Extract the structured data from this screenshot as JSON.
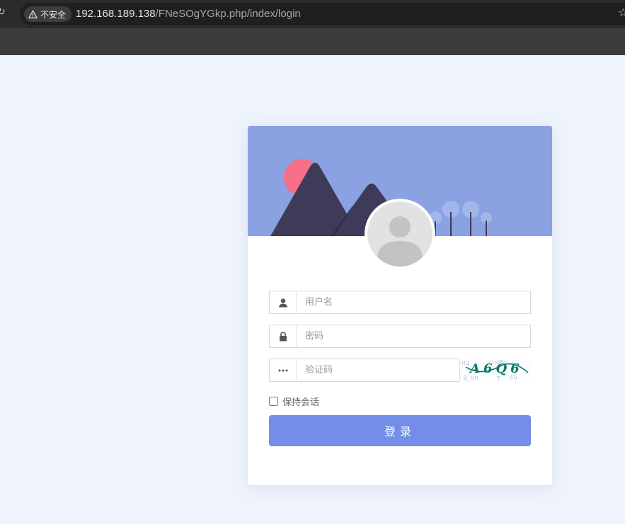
{
  "browser": {
    "security_label": "不安全",
    "url_host": "192.168.189.138",
    "url_path": "/FNeSOgYGkp.php/index/login"
  },
  "login": {
    "username_placeholder": "用户名",
    "password_placeholder": "密码",
    "captcha_placeholder": "验证码",
    "captcha_text": "A6Q6",
    "remember_label": "保持会话",
    "submit_label": "登录"
  },
  "colors": {
    "page_bg": "#eff3fc",
    "banner_bg": "#8aa1e2",
    "accent_button": "#738ee9",
    "sun": "#f76e87",
    "mountain": "#3f3a58",
    "captcha_text": "#0b7a66"
  }
}
